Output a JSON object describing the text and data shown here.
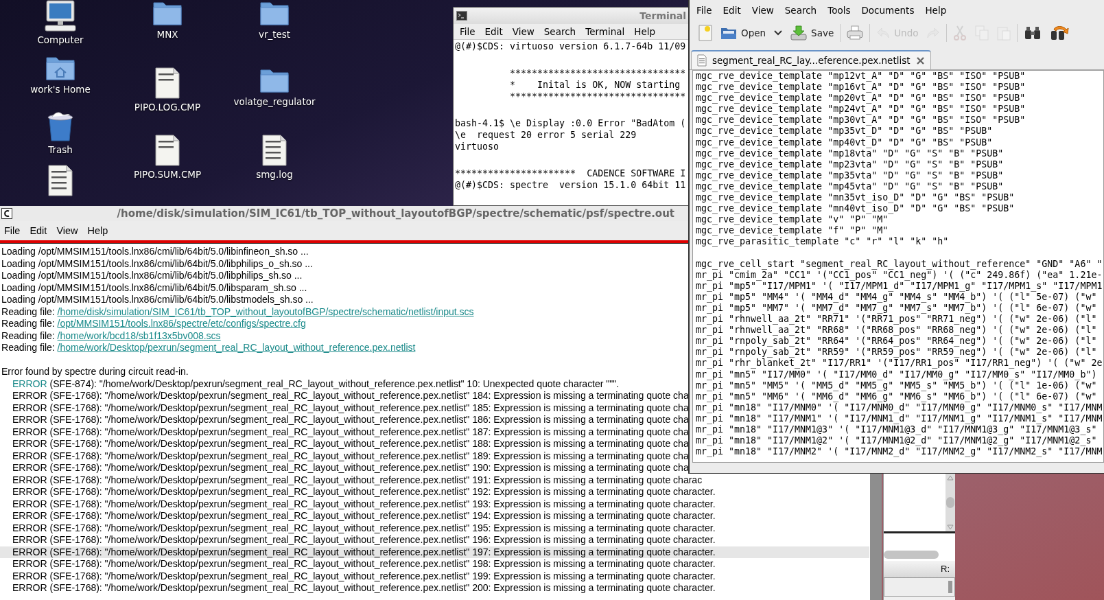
{
  "desktop": {
    "icon_columns": [
      [
        {
          "kind": "computer",
          "label": "Computer"
        },
        {
          "kind": "home",
          "label": "work's Home"
        },
        {
          "kind": "trash",
          "label": "Trash"
        },
        {
          "kind": "script"
        }
      ],
      [
        {
          "kind": "folder",
          "label": "MNX"
        },
        {
          "kind": "document",
          "label": "PIPO.LOG.CMP"
        },
        {
          "kind": "document",
          "label": "PIPO.SUM.CMP"
        }
      ],
      [
        {
          "kind": "folder",
          "label": "vr_test"
        },
        {
          "kind": "folder",
          "label": "volatge_regulator"
        },
        {
          "kind": "log",
          "label": "smg.log"
        }
      ]
    ]
  },
  "terminal": {
    "title": "Terminal",
    "menu": [
      "File",
      "Edit",
      "View",
      "Search",
      "Terminal",
      "Help"
    ],
    "blocks": [
      [
        "@(#)$CDS: virtuoso version 6.1.7-64b 11/09"
      ],
      [
        "          ********************************",
        "          *    Inital is OK, NOW starting",
        "          ********************************"
      ],
      [
        "bash-4.1$ \\e Display :0.0 Error \"BadAtom (",
        "\\e  request 20 error 5 serial 229",
        "virtuoso"
      ],
      [
        "**********************  CADENCE SOFTWARE I",
        "@(#)$CDS: spectre  version 15.1.0 64bit 11"
      ]
    ]
  },
  "log_window": {
    "title": "/home/disk/simulation/SIM_IC61/tb_TOP_without_layoutofBGP/spectre/schematic/psf/spectre.out",
    "menu": [
      "File",
      "Edit",
      "View",
      "Help"
    ],
    "sections": [
      [
        {
          "kind": "plain",
          "text": "Loading /opt/MMSIM151/tools.lnx86/cmi/lib/64bit/5.0/libinfineon_sh.so ...",
          "selected": false
        },
        {
          "kind": "plain",
          "text": "Loading /opt/MMSIM151/tools.lnx86/cmi/lib/64bit/5.0/libphilips_o_sh.so ...",
          "selected": false
        },
        {
          "kind": "plain",
          "text": "Loading /opt/MMSIM151/tools.lnx86/cmi/lib/64bit/5.0/libphilips_sh.so ...",
          "selected": false
        },
        {
          "kind": "plain",
          "text": "Loading /opt/MMSIM151/tools.lnx86/cmi/lib/64bit/5.0/libsparam_sh.so ...",
          "selected": false
        },
        {
          "kind": "plain",
          "text": "Loading /opt/MMSIM151/tools.lnx86/cmi/lib/64bit/5.0/libstmodels_sh.so ...",
          "selected": false
        },
        {
          "kind": "file",
          "text": "Reading file:",
          "path": "/home/disk/simulation/SIM_IC61/tb_TOP_without_layoutofBGP/spectre/schematic/netlist/input.scs",
          "selected": false
        },
        {
          "kind": "file",
          "text": "Reading file:",
          "path": "/opt/MMSIM151/tools.lnx86/spectre/etc/configs/spectre.cfg",
          "selected": false
        },
        {
          "kind": "file",
          "text": "Reading file:",
          "path": "/home/work/bcd18/sb1f13x5bv008.scs",
          "selected": false
        },
        {
          "kind": "file",
          "text": "Reading file:",
          "path": "/home/work/Desktop/pexrun/segment_real_RC_layout_without_reference.pex.netlist",
          "selected": false
        }
      ],
      [
        {
          "kind": "plain",
          "text": "Error found by spectre during circuit read-in.",
          "selected": false
        },
        {
          "kind": "error",
          "code": "ERROR",
          "linked": true,
          "text": "(SFE-874): \"/home/work/Desktop/pexrun/segment_real_RC_layout_without_reference.pex.netlist\" 10: Unexpected quote character \"\"\".",
          "selected": false
        },
        {
          "kind": "error",
          "code": "ERROR",
          "linked": false,
          "text": "(SFE-1768): \"/home/work/Desktop/pexrun/segment_real_RC_layout_without_reference.pex.netlist\" 184: Expression is missing a terminating quote cha",
          "selected": false
        },
        {
          "kind": "error",
          "code": "ERROR",
          "linked": false,
          "text": "(SFE-1768): \"/home/work/Desktop/pexrun/segment_real_RC_layout_without_reference.pex.netlist\" 185: Expression is missing a terminating quote cha",
          "selected": false
        },
        {
          "kind": "error",
          "code": "ERROR",
          "linked": false,
          "text": "(SFE-1768): \"/home/work/Desktop/pexrun/segment_real_RC_layout_without_reference.pex.netlist\" 186: Expression is missing a terminating quote cha",
          "selected": false
        },
        {
          "kind": "error",
          "code": "ERROR",
          "linked": false,
          "text": "(SFE-1768): \"/home/work/Desktop/pexrun/segment_real_RC_layout_without_reference.pex.netlist\" 187: Expression is missing a terminating quote cha",
          "selected": false
        },
        {
          "kind": "error",
          "code": "ERROR",
          "linked": false,
          "text": "(SFE-1768): \"/home/work/Desktop/pexrun/segment_real_RC_layout_without_reference.pex.netlist\" 188: Expression is missing a terminating quote cha",
          "selected": false
        },
        {
          "kind": "error",
          "code": "ERROR",
          "linked": false,
          "text": "(SFE-1768): \"/home/work/Desktop/pexrun/segment_real_RC_layout_without_reference.pex.netlist\" 189: Expression is missing a terminating quote cha",
          "selected": false
        },
        {
          "kind": "error",
          "code": "ERROR",
          "linked": false,
          "text": "(SFE-1768): \"/home/work/Desktop/pexrun/segment_real_RC_layout_without_reference.pex.netlist\" 190: Expression is missing a terminating quote cha",
          "selected": false
        },
        {
          "kind": "error",
          "code": "ERROR",
          "linked": false,
          "text": "(SFE-1768): \"/home/work/Desktop/pexrun/segment_real_RC_layout_without_reference.pex.netlist\" 191: Expression is missing a terminating quote charac",
          "selected": false
        },
        {
          "kind": "error",
          "code": "ERROR",
          "linked": false,
          "text": "(SFE-1768): \"/home/work/Desktop/pexrun/segment_real_RC_layout_without_reference.pex.netlist\" 192: Expression is missing a terminating quote character.",
          "selected": false
        },
        {
          "kind": "error",
          "code": "ERROR",
          "linked": false,
          "text": "(SFE-1768): \"/home/work/Desktop/pexrun/segment_real_RC_layout_without_reference.pex.netlist\" 193: Expression is missing a terminating quote character.",
          "selected": false
        },
        {
          "kind": "error",
          "code": "ERROR",
          "linked": false,
          "text": "(SFE-1768): \"/home/work/Desktop/pexrun/segment_real_RC_layout_without_reference.pex.netlist\" 194: Expression is missing a terminating quote character.",
          "selected": false
        },
        {
          "kind": "error",
          "code": "ERROR",
          "linked": false,
          "text": "(SFE-1768): \"/home/work/Desktop/pexrun/segment_real_RC_layout_without_reference.pex.netlist\" 195: Expression is missing a terminating quote character.",
          "selected": false
        },
        {
          "kind": "error",
          "code": "ERROR",
          "linked": false,
          "text": "(SFE-1768): \"/home/work/Desktop/pexrun/segment_real_RC_layout_without_reference.pex.netlist\" 196: Expression is missing a terminating quote character.",
          "selected": false
        },
        {
          "kind": "error",
          "code": "ERROR",
          "linked": false,
          "text": "(SFE-1768): \"/home/work/Desktop/pexrun/segment_real_RC_layout_without_reference.pex.netlist\" 197: Expression is missing a terminating quote character.",
          "selected": true
        },
        {
          "kind": "error",
          "code": "ERROR",
          "linked": false,
          "text": "(SFE-1768): \"/home/work/Desktop/pexrun/segment_real_RC_layout_without_reference.pex.netlist\" 198: Expression is missing a terminating quote character.",
          "selected": false
        },
        {
          "kind": "error",
          "code": "ERROR",
          "linked": false,
          "text": "(SFE-1768): \"/home/work/Desktop/pexrun/segment_real_RC_layout_without_reference.pex.netlist\" 199: Expression is missing a terminating quote character.",
          "selected": false
        },
        {
          "kind": "error",
          "code": "ERROR",
          "linked": false,
          "text": "(SFE-1768): \"/home/work/Desktop/pexrun/segment_real_RC_layout_without_reference.pex.netlist\" 200: Expression is missing a terminating quote character.",
          "selected": false
        }
      ]
    ]
  },
  "editor": {
    "menu": [
      "File",
      "Edit",
      "View",
      "Search",
      "Tools",
      "Documents",
      "Help"
    ],
    "toolbar": [
      {
        "kind": "new",
        "disabled": false
      },
      {
        "kind": "open",
        "label": "Open",
        "disabled": false
      },
      {
        "kind": "dropdown",
        "disabled": false
      },
      {
        "kind": "save",
        "label": "Save",
        "disabled": false
      },
      {
        "kind": "separator"
      },
      {
        "kind": "print",
        "disabled": false
      },
      {
        "kind": "separator"
      },
      {
        "kind": "undo",
        "label": "Undo",
        "disabled": true
      },
      {
        "kind": "redo",
        "disabled": true
      },
      {
        "kind": "separator"
      },
      {
        "kind": "cut",
        "disabled": true
      },
      {
        "kind": "copy",
        "disabled": true
      },
      {
        "kind": "paste",
        "disabled": true
      },
      {
        "kind": "separator"
      },
      {
        "kind": "find",
        "disabled": false
      },
      {
        "kind": "replace",
        "disabled": false
      }
    ],
    "tabs": [
      {
        "label": "segment_real_RC_lay...eference.pex.netlist",
        "selected": true
      }
    ],
    "blocks": [
      [
        "mgc_rve_device_template \"mp12vt_A\" \"D\" \"G\" \"BS\" \"ISO\" \"PSUB\"",
        "mgc_rve_device_template \"mp16vt_A\" \"D\" \"G\" \"BS\" \"ISO\" \"PSUB\"",
        "mgc_rve_device_template \"mp20vt_A\" \"D\" \"G\" \"BS\" \"ISO\" \"PSUB\"",
        "mgc_rve_device_template \"mp24vt_A\" \"D\" \"G\" \"BS\" \"ISO\" \"PSUB\"",
        "mgc_rve_device_template \"mp30vt_A\" \"D\" \"G\" \"BS\" \"ISO\" \"PSUB\"",
        "mgc_rve_device_template \"mp35vt_D\" \"D\" \"G\" \"BS\" \"PSUB\"",
        "mgc_rve_device_template \"mp40vt_D\" \"D\" \"G\" \"BS\" \"PSUB\"",
        "mgc_rve_device_template \"mp18vta\" \"D\" \"G\" \"S\" \"B\" \"PSUB\"",
        "mgc_rve_device_template \"mp23vta\" \"D\" \"G\" \"S\" \"B\" \"PSUB\"",
        "mgc_rve_device_template \"mp35vta\" \"D\" \"G\" \"S\" \"B\" \"PSUB\"",
        "mgc_rve_device_template \"mp45vta\" \"D\" \"G\" \"S\" \"B\" \"PSUB\"",
        "mgc_rve_device_template \"mn35vt_iso_D\" \"D\" \"G\" \"BS\" \"PSUB\"",
        "mgc_rve_device_template \"mn40vt_iso_D\" \"D\" \"G\" \"BS\" \"PSUB\"",
        "mgc_rve_device_template \"v\" \"P\" \"M\"",
        "mgc_rve_device_template \"f\" \"P\" \"M\"",
        "mgc_rve_parasitic_template \"c\" \"r\" \"l\" \"k\" \"h\""
      ],
      [
        "mgc_rve_cell_start \"segment_real_RC_layout_without_reference\" \"GND\" \"A6\" \"",
        "mr_pi \"cmim_2a\" \"CC1\" '(\"CC1_pos\" \"CC1_neg\") '( (\"c\" 249.86f) (\"ea\" 1.21e-",
        "mr_pi \"mp5\" \"I17/MPM1\" '( \"I17/MPM1_d\" \"I17/MPM1_g\" \"I17/MPM1_s\" \"I17/MPM1",
        "mr_pi \"mp5\" \"MM4\" '( \"MM4_d\" \"MM4_g\" \"MM4_s\" \"MM4_b\") '( (\"l\" 5e-07) (\"w\"",
        "mr_pi \"mp5\" \"MM7\" '( \"MM7_d\" \"MM7_g\" \"MM7_s\" \"MM7_b\") '( (\"l\" 6e-07) (\"w\"",
        "mr_pi \"rhnwell_aa_2t\" \"RR71\" '(\"RR71_pos\" \"RR71_neg\") '( (\"w\" 2e-06) (\"l\"",
        "mr_pi \"rhnwell_aa_2t\" \"RR68\" '(\"RR68_pos\" \"RR68_neg\") '( (\"w\" 2e-06) (\"l\"",
        "mr_pi \"rnpoly_sab_2t\" \"RR64\" '(\"RR64_pos\" \"RR64_neg\") '( (\"w\" 2e-06) (\"l\"",
        "mr_pi \"rnpoly_sab_2t\" \"RR59\" '(\"RR59_pos\" \"RR59_neg\") '( (\"w\" 2e-06) (\"l\"",
        "mr_pi \"rhr_blanket_2t\" \"I17/RR1\" '(\"I17/RR1_pos\" \"I17/RR1_neg\") '( (\"w\" 2e",
        "mr_pi \"mn5\" \"I17/MM0\" '( \"I17/MM0_d\" \"I17/MM0_g\" \"I17/MM0_s\" \"I17/MM0_b\")",
        "mr_pi \"mn5\" \"MM5\" '( \"MM5_d\" \"MM5_g\" \"MM5_s\" \"MM5_b\") '( (\"l\" 1e-06) (\"w\"",
        "mr_pi \"mn5\" \"MM6\" '( \"MM6_d\" \"MM6_g\" \"MM6_s\" \"MM6_b\") '( (\"l\" 6e-07) (\"w\"",
        "mr_pi \"mn18\" \"I17/MNM0\" '( \"I17/MNM0_d\" \"I17/MNM0_g\" \"I17/MNM0_s\" \"I17/MNM",
        "mr_pi \"mn18\" \"I17/MNM1\" '( \"I17/MNM1_d\" \"I17/MNM1_g\" \"I17/MNM1_s\" \"I17/MNM",
        "mr_pi \"mn18\" \"I17/MNM1@3\" '( \"I17/MNM1@3_d\" \"I17/MNM1@3_g\" \"I17/MNM1@3_s\"",
        "mr_pi \"mn18\" \"I17/MNM1@2\" '( \"I17/MNM1@2_d\" \"I17/MNM1@2_g\" \"I17/MNM1@2_s\"",
        "mr_pi \"mn18\" \"I17/MNM2\" '( \"I17/MNM2_d\" \"I17/MNM2_g\" \"I17/MNM2_s\" \"I17/MNM"
      ]
    ]
  },
  "side_panel": {
    "label": "R:"
  }
}
